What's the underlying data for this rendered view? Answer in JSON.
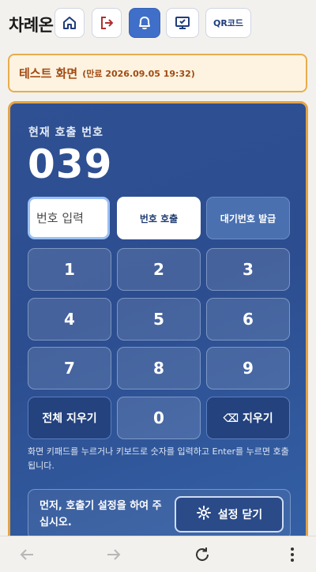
{
  "header": {
    "brand": "차례온",
    "nav": [
      {
        "icon": "home-icon"
      },
      {
        "icon": "logout-icon"
      },
      {
        "icon": "bell-icon",
        "active": true
      },
      {
        "icon": "monitor-icon"
      },
      {
        "label": "QR코드"
      }
    ],
    "accent_color": "#3f6fc8"
  },
  "banner": {
    "title": "테스트 화면",
    "subtitle": "(만료 2026.09.05 19:32)",
    "color": "#a24a12"
  },
  "panel": {
    "current_label": "현재 호출 번호",
    "current_number": "039",
    "input_placeholder": "번호 입력",
    "call_button": "번호 호출",
    "issue_button": "대기번호 발급",
    "keys": [
      "1",
      "2",
      "3",
      "4",
      "5",
      "6",
      "7",
      "8",
      "9"
    ],
    "clear_all": "전체 지우기",
    "zero": "0",
    "backspace": "⌫ 지우기",
    "hint": "화면 키패드를 누르거나 키보드로 숫자를 입력하고 Enter를 누르면 호출됩니다.",
    "notice": "먼저, 호출기 설정을 하여 주십시오.",
    "settings_button": "설정 닫기"
  },
  "browser_bar": {
    "icons": [
      "back-icon",
      "forward-icon",
      "reload-icon",
      "more-icon"
    ]
  }
}
